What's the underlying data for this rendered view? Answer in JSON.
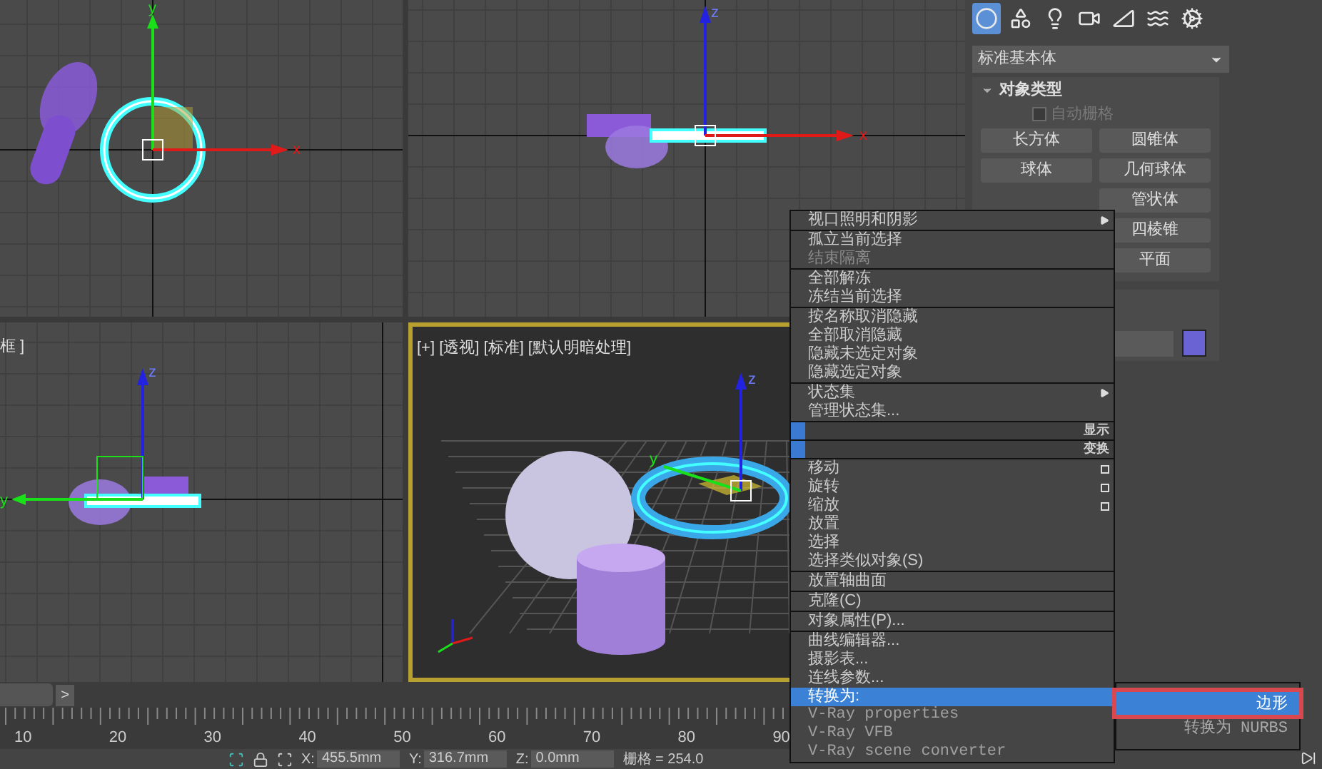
{
  "viewports": [
    {
      "kind": "top",
      "axis_labels": [
        "y",
        "x"
      ]
    },
    {
      "kind": "front",
      "axis_labels": [
        "z",
        "x"
      ]
    },
    {
      "kind": "left",
      "label": "框 ]",
      "axis_labels": [
        "z",
        "y"
      ]
    },
    {
      "kind": "perspective",
      "label": "[+] [透视] [标准] [默认明暗处理]",
      "axis_labels": [
        "z",
        "y"
      ],
      "active": true
    }
  ],
  "command_panel": {
    "tabs": [
      {
        "kind": "geometry",
        "selected": true
      },
      {
        "kind": "shapes",
        "selected": false
      },
      {
        "kind": "lights",
        "selected": false
      },
      {
        "kind": "cameras",
        "selected": false
      },
      {
        "kind": "helpers",
        "selected": false
      },
      {
        "kind": "spacewarps",
        "selected": false
      },
      {
        "kind": "systems",
        "selected": false
      }
    ],
    "category": "标准基本体",
    "object_type": {
      "title": "对象类型",
      "expanded": true,
      "autogrid": {
        "label": "自动栅格",
        "checked": false,
        "disabled": true
      },
      "left_buttons": [
        "长方体",
        "球体"
      ],
      "right_buttons": [
        "圆锥体",
        "几何球体",
        "管状体",
        "四棱锥",
        "平面"
      ]
    },
    "name_color": {
      "color": "#6a63d4"
    }
  },
  "context_menu": {
    "sections": [
      [
        {
          "label": "视口照明和阴影",
          "kind": "submenu",
          "disabled": false
        }
      ],
      [
        {
          "label": "孤立当前选择",
          "kind": "item",
          "disabled": false
        },
        {
          "label": "结束隔离",
          "kind": "item",
          "disabled": true
        }
      ],
      [
        {
          "label": "全部解冻",
          "kind": "item",
          "disabled": false
        },
        {
          "label": "冻结当前选择",
          "kind": "item",
          "disabled": false
        }
      ],
      [
        {
          "label": "按名称取消隐藏",
          "kind": "item",
          "disabled": false
        },
        {
          "label": "全部取消隐藏",
          "kind": "item",
          "disabled": false
        },
        {
          "label": "隐藏未选定对象",
          "kind": "item",
          "disabled": false
        },
        {
          "label": "隐藏选定对象",
          "kind": "item",
          "disabled": false
        }
      ],
      [
        {
          "label": "状态集",
          "kind": "submenu",
          "disabled": false
        },
        {
          "label": "管理状态集...",
          "kind": "item",
          "disabled": false
        }
      ],
      [
        {
          "label": "显示",
          "kind": "header"
        }
      ],
      [
        {
          "label": "变换",
          "kind": "header"
        }
      ],
      [
        {
          "label": "移动",
          "kind": "option",
          "disabled": false
        },
        {
          "label": "旋转",
          "kind": "option",
          "disabled": false
        },
        {
          "label": "缩放",
          "kind": "option",
          "disabled": false
        },
        {
          "label": "放置",
          "kind": "item",
          "disabled": false
        },
        {
          "label": "选择",
          "kind": "item",
          "disabled": false
        },
        {
          "label": "选择类似对象(S)",
          "kind": "item",
          "disabled": false
        }
      ],
      [
        {
          "label": "放置轴曲面",
          "kind": "item",
          "disabled": false
        }
      ],
      [
        {
          "label": "克隆(C)",
          "kind": "item",
          "disabled": false
        }
      ],
      [
        {
          "label": "对象属性(P)...",
          "kind": "item",
          "disabled": false
        }
      ],
      [
        {
          "label": "曲线编辑器...",
          "kind": "item",
          "disabled": false
        },
        {
          "label": "摄影表...",
          "kind": "item",
          "disabled": false
        },
        {
          "label": "连线参数...",
          "kind": "item",
          "disabled": false
        },
        {
          "label": "转换为:",
          "kind": "item",
          "disabled": false,
          "selected": true
        },
        {
          "label": "V-Ray properties",
          "kind": "plugin",
          "disabled": false
        },
        {
          "label": "V-Ray VFB",
          "kind": "plugin",
          "disabled": false
        },
        {
          "label": "V-Ray scene converter",
          "kind": "plugin",
          "disabled": false
        }
      ]
    ]
  },
  "submenu": {
    "items": [
      {
        "label": "边形",
        "selected": true,
        "highlighted": true
      },
      {
        "label": "转换为 NURBS",
        "selected": false,
        "highlighted": false
      }
    ]
  },
  "timeline": {
    "next": ">",
    "ticks": [
      "10",
      "20",
      "30",
      "40",
      "50",
      "60",
      "70",
      "80",
      "90"
    ]
  },
  "status_bar": {
    "fields": [
      {
        "label": "X:",
        "value": "455.5mm"
      },
      {
        "label": "Y:",
        "value": "316.7mm"
      },
      {
        "label": "Z:",
        "value": "0.0mm"
      }
    ],
    "grid": "栅格 = 254.0"
  }
}
